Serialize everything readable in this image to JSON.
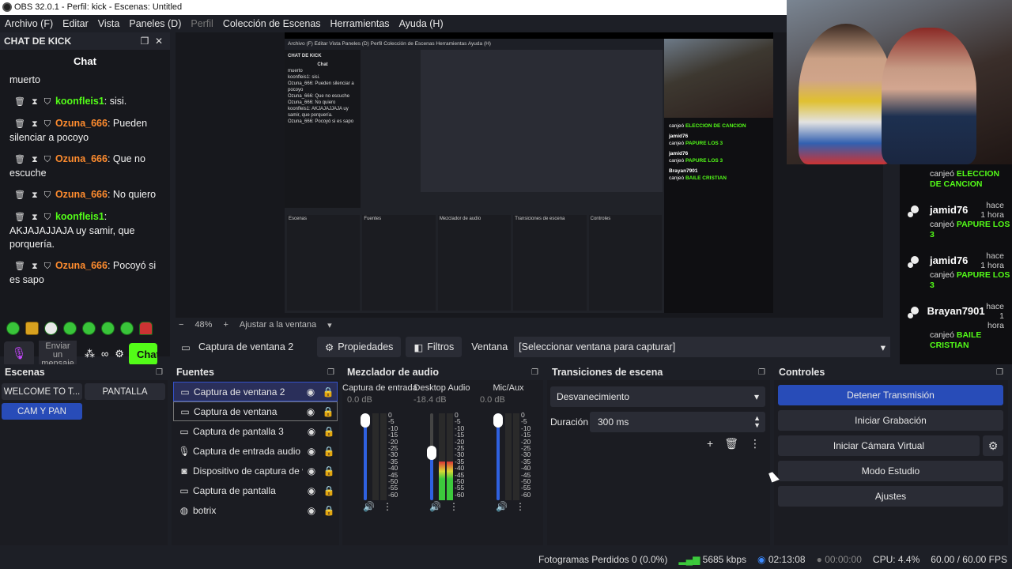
{
  "window": {
    "title": "OBS 32.0.1 - Perfil: kick - Escenas: Untitled"
  },
  "menubar": [
    {
      "label": "Archivo (F)"
    },
    {
      "label": "Editar"
    },
    {
      "label": "Vista"
    },
    {
      "label": "Paneles (D)"
    },
    {
      "label": "Perfil"
    },
    {
      "label": "Colección de Escenas"
    },
    {
      "label": "Herramientas"
    },
    {
      "label": "Ayuda (H)"
    }
  ],
  "chat": {
    "dock_title": "CHAT DE KICK",
    "tab": "Chat",
    "messages": [
      {
        "user": "",
        "text": "muerto"
      },
      {
        "user": "koonfleis1",
        "text": " sisi.",
        "color": "green"
      },
      {
        "user": "Ozuna_666",
        "text": " Pueden silenciar a pocoyo",
        "color": "orange"
      },
      {
        "user": "Ozuna_666",
        "text": " Que no escuche",
        "color": "orange"
      },
      {
        "user": "Ozuna_666",
        "text": " No quiero",
        "color": "orange"
      },
      {
        "user": "koonfleis1",
        "text": " AKJAJAJJAJA uy samir, que porquería.",
        "color": "green"
      },
      {
        "user": "Ozuna_666",
        "text": " Pocoyó si es sapo",
        "color": "orange"
      }
    ],
    "input_placeholder": "Enviar un mensaje",
    "send_label": "Chat"
  },
  "preview": {
    "zoom": "48%",
    "zoom_minus": "−",
    "zoom_plus": "+",
    "fit_label": "Ajustar a la ventana",
    "mini_menubar": "Archivo (F)   Editar   Vista   Paneles (D)   Perfil   Colección de Escenas   Herramientas   Ayuda (H)",
    "mini_chat_title": "CHAT DE KICK",
    "mini_chat_lines": [
      "Chat",
      "muerto",
      "koonfleis1: sisi.",
      "Ozuna_666: Pueden silenciar a pocoyo",
      "Ozuna_666: Que no escuche",
      "Ozuna_666: No quiero",
      "koonfleis1: AKJAJAJJAJA uy samir, que porquería.",
      "Ozuna_666: Pocoyó si es sapo"
    ],
    "mini_docks": [
      "Escenas",
      "Fuentes",
      "Mezclador de audio",
      "Transiciones de escena",
      "Controles"
    ],
    "mini_side": [
      {
        "pre": "canjeó ",
        "g": "ELECCION DE CANCION"
      },
      {
        "pre": "jamid76",
        "g": ""
      },
      {
        "pre": "canjeó ",
        "g": "PAPURE LOS 3"
      },
      {
        "pre": "jamid76",
        "g": ""
      },
      {
        "pre": "canjeó ",
        "g": "PAPURE LOS 3"
      },
      {
        "pre": "Brayan7901",
        "g": ""
      },
      {
        "pre": "canjeó ",
        "g": "BAILE CRISTIAN"
      }
    ]
  },
  "side_chat": {
    "top_line": {
      "pre": "canjeó",
      "highlight": "ELECCION DE CANCION"
    },
    "entries": [
      {
        "name": "jamid76",
        "time": "hace 1 hora",
        "pre": "canjeó",
        "highlight": "PAPURE LOS 3"
      },
      {
        "name": "jamid76",
        "time": "hace 1 hora",
        "pre": "canjeó",
        "highlight": "PAPURE LOS 3"
      },
      {
        "name": "Brayan7901",
        "time": "hace 1 hora",
        "pre": "canjeó",
        "highlight": "BAILE CRISTIAN"
      }
    ]
  },
  "propbar": {
    "source_name": "Captura de ventana 2",
    "properties_label": "Propiedades",
    "filters_label": "Filtros",
    "window_label": "Ventana",
    "window_value": "[Seleccionar ventana para capturar]"
  },
  "scenes": {
    "title": "Escenas",
    "items": [
      {
        "label": "WELCOME TO T...",
        "active": false
      },
      {
        "label": "PANTALLA",
        "active": false
      },
      {
        "label": "CAM Y PAN",
        "active": true
      }
    ]
  },
  "sources": {
    "title": "Fuentes",
    "items": [
      {
        "label": "Captura de ventana 2",
        "icon": "window-icon"
      },
      {
        "label": "Captura de ventana",
        "icon": "window-icon"
      },
      {
        "label": "Captura de pantalla 3",
        "icon": "monitor-icon"
      },
      {
        "label": "Captura de entrada audio",
        "icon": "microphone-icon"
      },
      {
        "label": "Dispositivo de captura de vídeo",
        "icon": "camera-icon"
      },
      {
        "label": "Captura de pantalla",
        "icon": "monitor-icon"
      },
      {
        "label": "botrix",
        "icon": "globe-icon"
      }
    ]
  },
  "mixer": {
    "title": "Mezclador de audio",
    "channels": [
      {
        "name": "Captura de entrada",
        "db": "0.0 dB",
        "fader": 1.0,
        "level": 0.0
      },
      {
        "name": "Desktop Audio",
        "db": "-18.4 dB",
        "fader": 0.55,
        "level": 0.45
      },
      {
        "name": "Mic/Aux",
        "db": "0.0 dB",
        "fader": 1.0,
        "level": 0.0
      }
    ],
    "scale": [
      "0",
      "-5",
      "-10",
      "-15",
      "-20",
      "-25",
      "-30",
      "-35",
      "-40",
      "-45",
      "-50",
      "-55",
      "-60"
    ]
  },
  "transitions": {
    "title": "Transiciones de escena",
    "selected": "Desvanecimiento",
    "duration_label": "Duración",
    "duration_value": "300 ms"
  },
  "controls": {
    "title": "Controles",
    "buttons": {
      "stream": "Detener Transmisión",
      "record": "Iniciar Grabación",
      "virtual_cam": "Iniciar Cámara Virtual",
      "studio": "Modo Estudio",
      "settings": "Ajustes"
    }
  },
  "status": {
    "dropped": "Fotogramas Perdidos 0 (0.0%)",
    "bitrate": "5685 kbps",
    "live_time": "02:13:08",
    "rec_time": "00:00:00",
    "cpu": "CPU: 4.4%",
    "fps": "60.00 / 60.00 FPS"
  },
  "colors": {
    "accent": "#284cb8",
    "kick_green": "#53fc18",
    "user_orange": "#ff8c2e"
  }
}
